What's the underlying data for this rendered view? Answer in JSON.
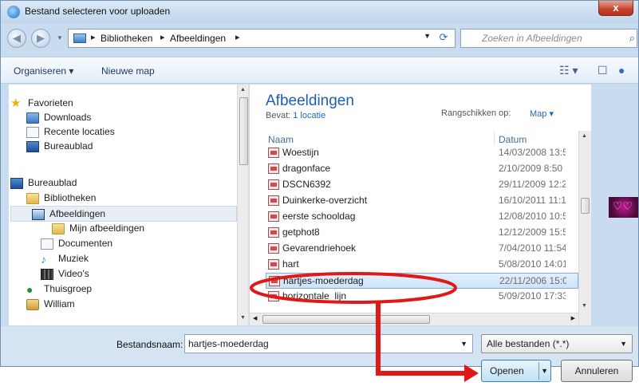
{
  "window": {
    "title": "Bestand selecteren voor uploaden",
    "close_label": "x"
  },
  "address": {
    "crumbs": [
      "Bibliotheken",
      "Afbeeldingen"
    ],
    "search_placeholder": "Zoeken in Afbeeldingen"
  },
  "toolbar": {
    "organize": "Organiseren ▾",
    "new_folder": "Nieuwe map"
  },
  "nav": {
    "items": [
      {
        "label": "Favorieten",
        "icon": "star-icon"
      },
      {
        "label": "Downloads",
        "icon": "folder-icon"
      },
      {
        "label": "Recente locaties",
        "icon": "recent-places-icon"
      },
      {
        "label": "Bureaublad",
        "icon": "desktop-icon"
      },
      {
        "label": "Bureaublad",
        "icon": "desktop-icon"
      },
      {
        "label": "Bibliotheken",
        "icon": "library-icon"
      },
      {
        "label": "Afbeeldingen",
        "icon": "pictures-library-icon"
      },
      {
        "label": "Mijn afbeeldingen",
        "icon": "folder-icon"
      },
      {
        "label": "Documenten",
        "icon": "documents-icon"
      },
      {
        "label": "Muziek",
        "icon": "music-icon"
      },
      {
        "label": "Video's",
        "icon": "video-icon"
      },
      {
        "label": "Thuisgroep",
        "icon": "homegroup-icon"
      },
      {
        "label": "William",
        "icon": "user-folder-icon"
      }
    ],
    "selected": "Afbeeldingen"
  },
  "main": {
    "library_title": "Afbeeldingen",
    "contains_label": "Bevat:",
    "contains_link": "1 locatie",
    "arrange_label": "Rangschikken op:",
    "arrange_value": "Map ▾",
    "columns": {
      "name": "Naam",
      "date": "Datum"
    },
    "files": [
      {
        "name": "Woestijn",
        "date": "14/03/2008 13:5"
      },
      {
        "name": "dragonface",
        "date": "2/10/2009 8:50"
      },
      {
        "name": "DSCN6392",
        "date": "29/11/2009 12:2"
      },
      {
        "name": "Duinkerke-overzicht",
        "date": "16/10/2011 11:1"
      },
      {
        "name": "eerste schooldag",
        "date": "12/08/2010 10:5"
      },
      {
        "name": "getphot8",
        "date": "12/12/2009 15:5"
      },
      {
        "name": "Gevarendriehoek",
        "date": "7/04/2010 11:54"
      },
      {
        "name": "hart",
        "date": "5/08/2010 14:01"
      },
      {
        "name": "hartjes-moederdag",
        "date": "22/11/2006 15:0"
      },
      {
        "name": "horizontale_lijn",
        "date": "5/09/2010 17:33"
      }
    ],
    "selected_file": "hartjes-moederdag"
  },
  "bottom": {
    "filename_label": "Bestandsnaam:",
    "filename_value": "hartjes-moederdag",
    "filetype_value": "Alle bestanden (*.*)",
    "open_label": "Openen",
    "cancel_label": "Annuleren"
  },
  "colors": {
    "highlight_annotation": "#e01818",
    "link_blue": "#1f66c2"
  }
}
